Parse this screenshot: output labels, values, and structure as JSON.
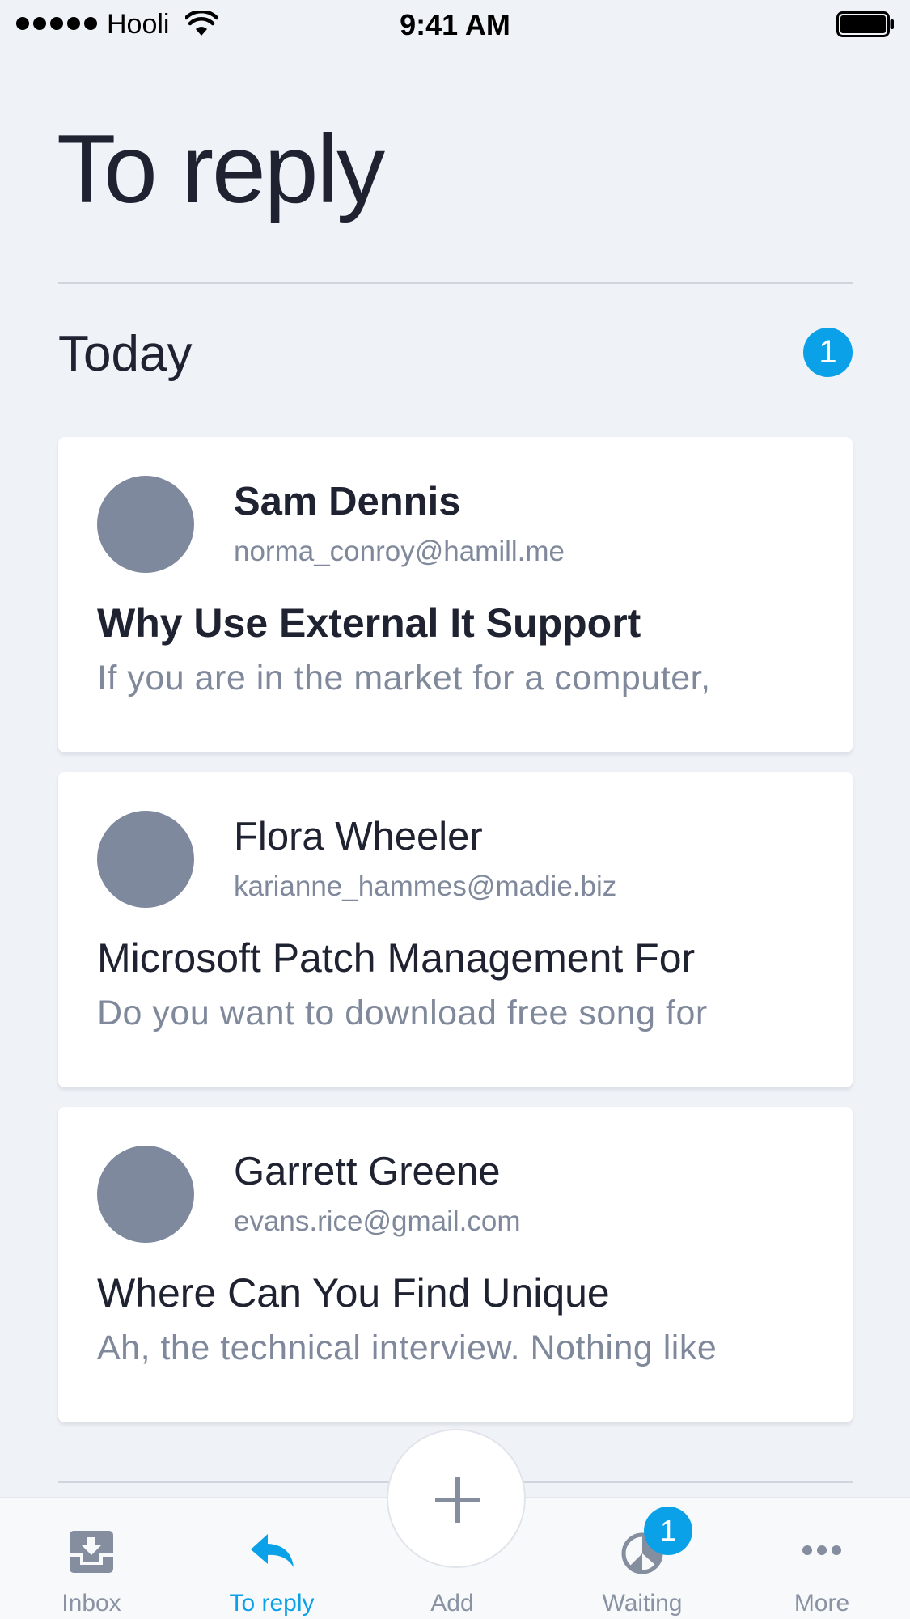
{
  "status_bar": {
    "carrier": "Hooli",
    "time": "9:41 AM"
  },
  "page": {
    "title": "To reply"
  },
  "section": {
    "title": "Today",
    "count": "1"
  },
  "messages": [
    {
      "sender": "Sam Dennis",
      "email": "norma_conroy@hamill.me",
      "subject": "Why Use External It Support",
      "preview": "If you are in the market for a computer,",
      "unread": true
    },
    {
      "sender": "Flora Wheeler",
      "email": "karianne_hammes@madie.biz",
      "subject": "Microsoft Patch Management For",
      "preview": "Do you want to download free song for",
      "unread": false
    },
    {
      "sender": "Garrett Greene",
      "email": "evans.rice@gmail.com",
      "subject": "Where Can You Find Unique",
      "preview": "Ah, the technical interview. Nothing like",
      "unread": false
    }
  ],
  "tab_bar": {
    "inbox": "Inbox",
    "to_reply": "To reply",
    "add": "Add",
    "waiting": "Waiting",
    "waiting_badge": "1",
    "more": "More"
  },
  "icons": {
    "inbox": "inbox-tray-icon",
    "to_reply": "reply-arrow-icon",
    "add": "plus-icon",
    "waiting": "clock-pie-icon",
    "more": "ellipsis-icon"
  },
  "colors": {
    "accent": "#0aa1e8",
    "background": "#eff2f7",
    "card": "#ffffff",
    "text_primary": "#1f2230",
    "text_secondary": "#7f899b",
    "avatar": "#7e899e",
    "tab_inactive": "#8a93a3"
  }
}
